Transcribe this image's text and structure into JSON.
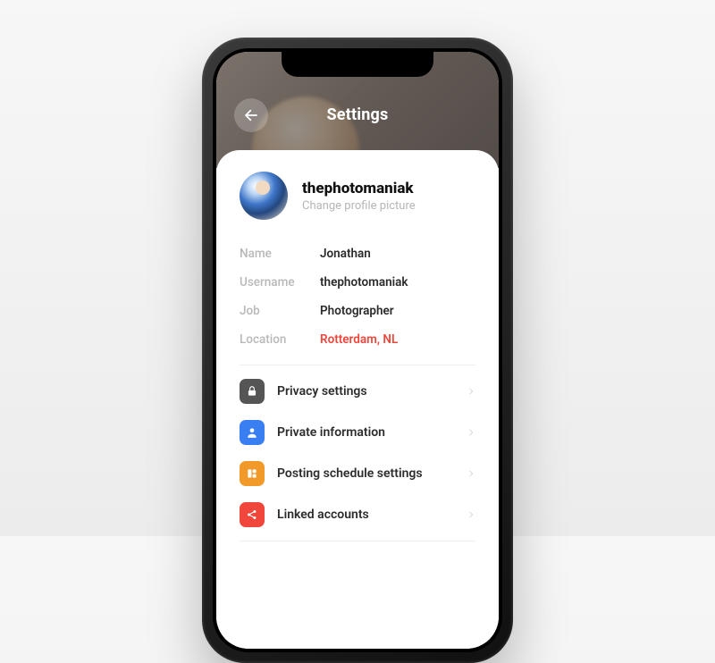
{
  "header": {
    "title": "Settings"
  },
  "profile": {
    "username_display": "thephotomaniak",
    "change_picture_label": "Change profile picture"
  },
  "fields": {
    "name": {
      "label": "Name",
      "value": "Jonathan"
    },
    "username": {
      "label": "Username",
      "value": "thephotomaniak"
    },
    "job": {
      "label": "Job",
      "value": "Photographer"
    },
    "location": {
      "label": "Location",
      "value": "Rotterdam, NL"
    }
  },
  "menu": {
    "privacy": {
      "label": "Privacy settings"
    },
    "private": {
      "label": "Private information"
    },
    "schedule": {
      "label": "Posting schedule settings"
    },
    "linked": {
      "label": "Linked accounts"
    }
  }
}
